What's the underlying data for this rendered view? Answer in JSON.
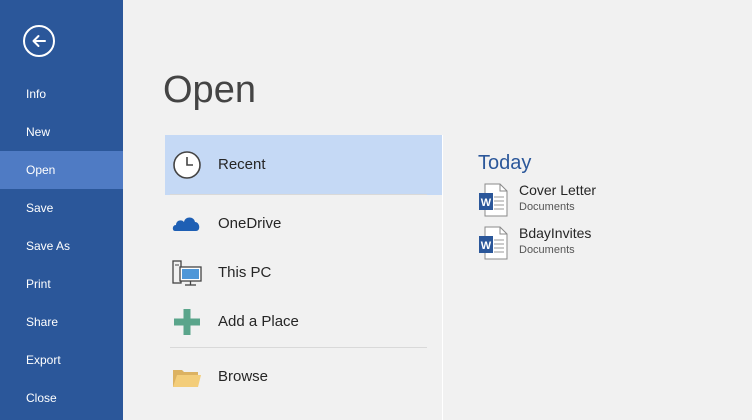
{
  "sidebar": {
    "back_icon": "arrow-left-circle-icon",
    "items": [
      {
        "label": "Info"
      },
      {
        "label": "New"
      },
      {
        "label": "Open",
        "active": true
      },
      {
        "label": "Save"
      },
      {
        "label": "Save As"
      },
      {
        "label": "Print"
      },
      {
        "label": "Share"
      },
      {
        "label": "Export"
      },
      {
        "label": "Close"
      }
    ]
  },
  "page": {
    "title": "Open"
  },
  "places": [
    {
      "label": "Recent",
      "icon": "clock-icon",
      "selected": true
    },
    {
      "label": "OneDrive",
      "icon": "cloud-icon"
    },
    {
      "label": "This PC",
      "icon": "computer-icon"
    },
    {
      "label": "Add a Place",
      "icon": "plus-icon"
    },
    {
      "label": "Browse",
      "icon": "folder-icon"
    }
  ],
  "recent": {
    "heading": "Today",
    "documents": [
      {
        "name": "Cover Letter",
        "location": "Documents",
        "icon": "word-document-icon"
      },
      {
        "name": "BdayInvites",
        "location": "Documents",
        "icon": "word-document-icon"
      }
    ]
  },
  "colors": {
    "sidebar": "#2b579a",
    "sidebar_active": "#4f7bc4",
    "selected_place": "#c5d9f5",
    "accent": "#2b579a"
  }
}
